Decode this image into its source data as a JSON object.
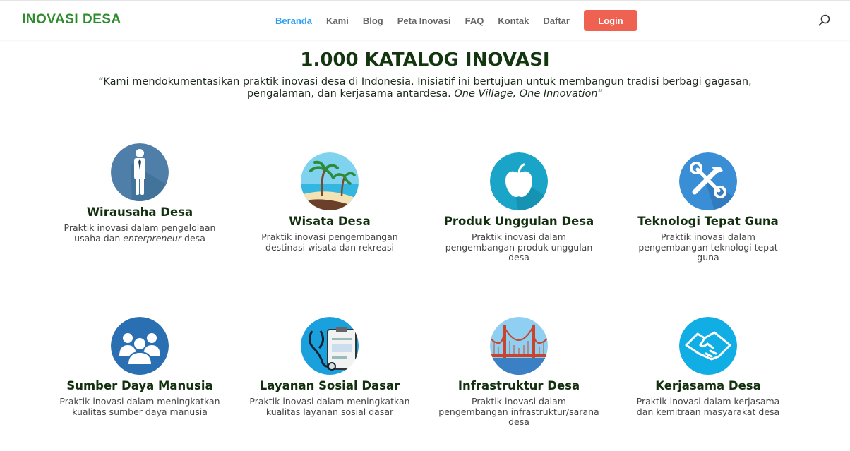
{
  "header": {
    "logo": "INOVASI DESA",
    "nav": [
      "Beranda",
      "Kami",
      "Blog",
      "Peta Inovasi",
      "FAQ",
      "Kontak",
      "Daftar"
    ],
    "login": "Login"
  },
  "hero": {
    "title": "1.000 KATALOG INOVASI",
    "quote_open": "“Kami mendokumentasikan praktik inovasi desa di Indonesia. Inisiatif ini bertujuan untuk membangun tradisi berbagi gagasan, pengalaman, dan kerjasama antardesa. ",
    "quote_em": "One Village, One Innovation",
    "quote_close": "“"
  },
  "categories": [
    {
      "title": "Wirausaha Desa",
      "desc_a": "Praktik inovasi dalam pengelolaan usaha dan ",
      "desc_em": "enterpreneur",
      "desc_b": " desa",
      "icon": "businessman-icon"
    },
    {
      "title": "Wisata Desa",
      "desc_a": "Praktik inovasi pengembangan destinasi wisata dan rekreasi",
      "desc_em": "",
      "desc_b": "",
      "icon": "beach-icon"
    },
    {
      "title": "Produk Unggulan Desa",
      "desc_a": "Praktik inovasi dalam pengembangan produk unggulan desa",
      "desc_em": "",
      "desc_b": "",
      "icon": "apple-icon"
    },
    {
      "title": "Teknologi Tepat Guna",
      "desc_a": "Praktik inovasi dalam pengembangan teknologi tepat guna",
      "desc_em": "",
      "desc_b": "",
      "icon": "tools-icon"
    },
    {
      "title": "Sumber Daya Manusia",
      "desc_a": "Praktik inovasi dalam meningkatkan kualitas sumber daya manusia",
      "desc_em": "",
      "desc_b": "",
      "icon": "people-icon"
    },
    {
      "title": "Layanan Sosial Dasar",
      "desc_a": "Praktik inovasi dalam meningkatkan kualitas layanan sosial dasar",
      "desc_em": "",
      "desc_b": "",
      "icon": "stethoscope-icon"
    },
    {
      "title": "Infrastruktur Desa",
      "desc_a": "Praktik inovasi dalam pengembangan infrastruktur/sarana desa",
      "desc_em": "",
      "desc_b": "",
      "icon": "bridge-icon"
    },
    {
      "title": "Kerjasama Desa",
      "desc_a": "Praktik inovasi dalam kerjasama dan kemitraan masyarakat desa",
      "desc_em": "",
      "desc_b": "",
      "icon": "handshake-icon"
    }
  ],
  "colors": {
    "brand_green": "#2e8b2e",
    "nav_active": "#2ea3f2",
    "login_red": "#ef6150",
    "heading_dark_green": "#13350f"
  }
}
